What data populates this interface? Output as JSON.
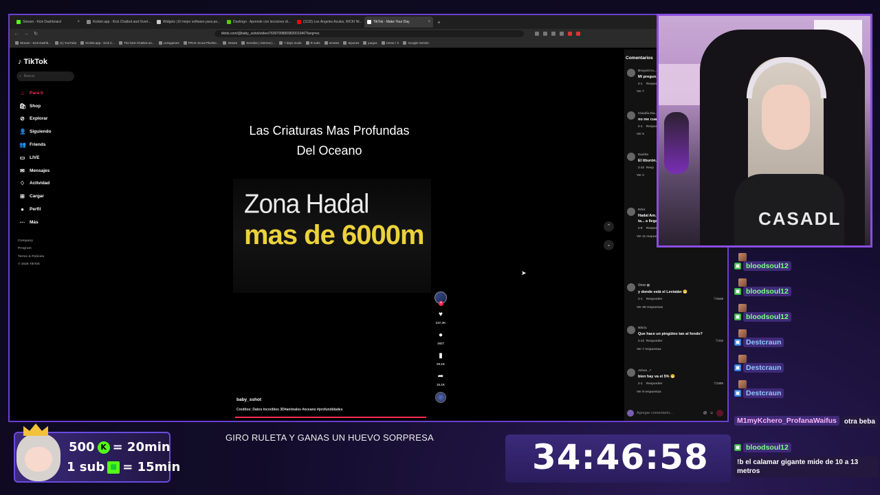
{
  "browser": {
    "tabs": [
      {
        "label": "Stream - Kick Dashboard",
        "color": "#53fc18",
        "active": false
      },
      {
        "label": "Kicklet.app - Kick Chatbot and Overl...",
        "color": "#8a8a8a",
        "active": false
      },
      {
        "label": "Widgets | El mejor software para pe...",
        "color": "#cccccc",
        "active": false
      },
      {
        "label": "Duolingo - Aprende con lecciones di...",
        "color": "#58cc02",
        "active": false
      },
      {
        "label": "(1132) Los Ángeles Azules, NICKI NI...",
        "color": "#ff0000",
        "active": false
      },
      {
        "label": "TikTok - Make Your Day",
        "color": "#ffffff",
        "active": true
      }
    ],
    "url": "tiktok.com/@baby_sshot/video/7600790890982001940?lang=es",
    "bookmarks": [
      "Stream - Kick Dashb...",
      "(1) YouTube",
      "Kicklet.app - Kick C...",
      "The best Chatbot an...",
      "Lessgames",
      "PRAK Scout Plushie...",
      "stream",
      "Servidor | Aternos |...",
      "7 days mods",
      "R subs",
      "emotes",
      "Iepones",
      "juegos",
      "Home / X",
      "Google Gemini"
    ]
  },
  "tiktok": {
    "logo": "TikTok",
    "search_placeholder": "Buscar",
    "nav": [
      {
        "icon": "home-icon",
        "glyph": "⌂",
        "label": "Para ti",
        "active": true
      },
      {
        "icon": "shop-icon",
        "glyph": "🛍",
        "label": "Shop",
        "active": false
      },
      {
        "icon": "explore-icon",
        "glyph": "⊘",
        "label": "Explorar",
        "active": false
      },
      {
        "icon": "following-icon",
        "glyph": "👤",
        "label": "Siguiendo",
        "active": false
      },
      {
        "icon": "friends-icon",
        "glyph": "👥",
        "label": "Friends",
        "active": false
      },
      {
        "icon": "live-icon",
        "glyph": "▭",
        "label": "LIVE",
        "active": false
      },
      {
        "icon": "messages-icon",
        "glyph": "✉",
        "label": "Mensajes",
        "active": false
      },
      {
        "icon": "activity-icon",
        "glyph": "♢",
        "label": "Actividad",
        "active": false
      },
      {
        "icon": "upload-icon",
        "glyph": "⊞",
        "label": "Cargar",
        "active": false
      },
      {
        "icon": "profile-icon",
        "glyph": "●",
        "label": "Perfil",
        "active": false
      },
      {
        "icon": "more-icon",
        "glyph": "···",
        "label": "Más",
        "active": false
      }
    ],
    "footer": [
      "Company",
      "Program",
      "Terms & Policies",
      "© 2026 TikTok"
    ],
    "video": {
      "title_line1": "Las Criaturas Mas Profundas",
      "title_line2": "Del Oceano",
      "frame_zona": "Zona Hadal",
      "frame_mas": "mas de 6000m",
      "likes": "237.2K",
      "comments": "1927",
      "saves": "29.1K",
      "shares": "15.1K",
      "author": "baby_sshot",
      "caption": "Creditos: Datos increibles 3D#animales #oceano #profundidades",
      "progress": 0.99
    },
    "comments_header": "Comentarios",
    "comments": [
      {
        "name": "BrayanCro...",
        "text": "Mi pregun...",
        "time": "2-1",
        "reply": "Respon",
        "likes": "",
        "more": "Ver 7"
      },
      {
        "name": "Claudia Dia...",
        "text": "no me cua...",
        "time": "2-1",
        "reply": "Respon",
        "likes": "",
        "more": "Ver 5"
      },
      {
        "name": "Davitto",
        "text": "El tiburón... más extra... de otro m...",
        "time": "2-10",
        "reply": "Resp",
        "likes": "",
        "more": "Ver 2"
      },
      {
        "name": "Edvz",
        "text": "Hadal Am... cosita peq... del mar, a... aterra y ta... a llegado l... más profunda sin explorar",
        "time": "2-9",
        "reply": "Responder",
        "likes": "1176",
        "more": "Ver 11 respuestas"
      },
      {
        "name": "ⵙ666 ▩",
        "text": "y donde está el Leviatán 😁",
        "time": "2-1",
        "reply": "Responder",
        "likes": "2549",
        "more": "Ver 49 respuestas"
      },
      {
        "name": "Nikria",
        "text": "Que hace un pingüino tan al fondo?",
        "time": "2-13",
        "reply": "Responder",
        "likes": "310",
        "more": "Ver 7 respuestas"
      },
      {
        "name": "Johan_.^",
        "text": "bien hay va el 5% 😁",
        "time": "2-1",
        "reply": "Responder",
        "likes": "2385",
        "more": "Ver 9 respuestas"
      }
    ],
    "add_comment_placeholder": "Agregar comentario..."
  },
  "webcam": {
    "shirt_text": "CASADL"
  },
  "chat": [
    {
      "user": "bloodsoul12",
      "color": "green",
      "badge": "green",
      "message": ""
    },
    {
      "user": "bloodsoul12",
      "color": "green",
      "badge": "green",
      "message": ""
    },
    {
      "user": "bloodsoul12",
      "color": "green",
      "badge": "green",
      "message": ""
    },
    {
      "user": "Destcraun",
      "color": "blue",
      "badge": "blue",
      "message": ""
    },
    {
      "user": "Destcraun",
      "color": "blue",
      "badge": "blue",
      "message": ""
    },
    {
      "user": "Destcraun",
      "color": "blue",
      "badge": "blue",
      "message": ""
    },
    {
      "user": "M1myKchero_ProfanaWaifus",
      "color": "pink",
      "badge": "",
      "message": "otra beba"
    },
    {
      "user": "bloodsoul12",
      "color": "green",
      "badge": "green",
      "message": "!b el calamar gigante mide de 10 a 13 metros"
    }
  ],
  "overlay": {
    "sub_line1_amount": "500",
    "sub_line1_rate": "= 20min",
    "sub_line2_amount": "1 sub",
    "sub_line2_rate": "= 15min",
    "ticker": "GIRO RULETA Y GANAS UN HUEVO SORPRESA",
    "timer": "34:46:58"
  }
}
